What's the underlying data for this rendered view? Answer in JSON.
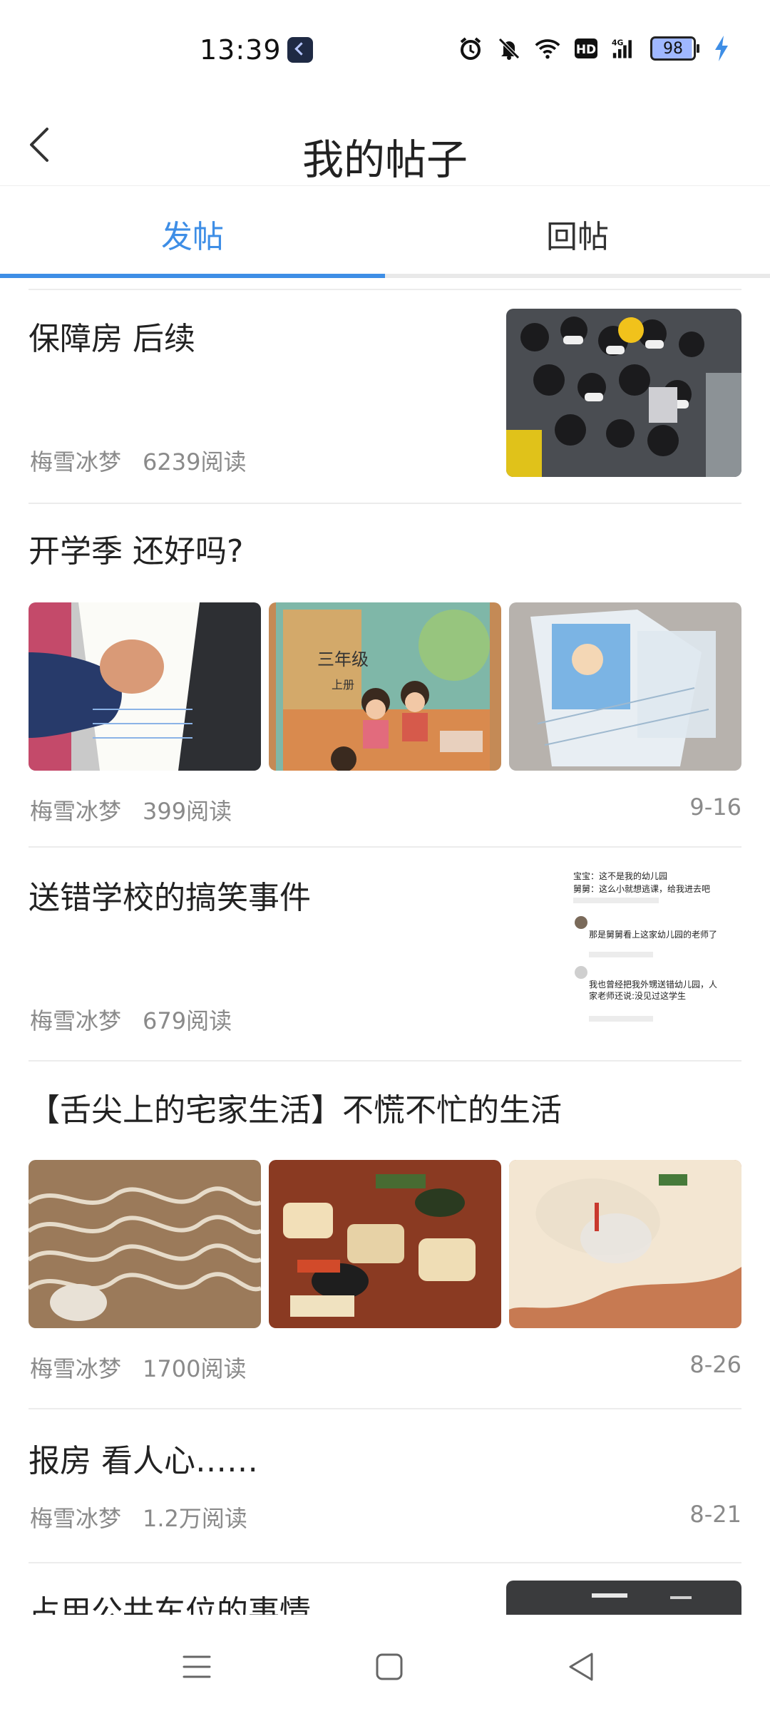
{
  "status_bar": {
    "time": "13:39",
    "battery": "98",
    "icons": [
      "alarm-icon",
      "mute-icon",
      "wifi-icon",
      "hd-icon",
      "4g-signal-icon",
      "battery-icon",
      "charging-icon"
    ]
  },
  "header": {
    "title": "我的帖子"
  },
  "tabs": [
    {
      "label": "发帖",
      "active": true
    },
    {
      "label": "回帖",
      "active": false
    }
  ],
  "colors": {
    "accent": "#3e8ee6"
  },
  "posts": [
    {
      "title": "保障房  后续",
      "author": "梅雪冰梦",
      "reads": "6239阅读",
      "date": ""
    },
    {
      "title": "开学季  还好吗?",
      "author": "梅雪冰梦",
      "reads": "399阅读",
      "date": "9-16",
      "image_labels": {
        "book_grade": "三年级",
        "book_volume": "上册"
      }
    },
    {
      "title": "送错学校的搞笑事件",
      "author": "梅雪冰梦",
      "reads": "679阅读",
      "date": "",
      "comment_screenshot": [
        "宝宝：这不是我的幼儿园",
        "舅舅：这么小就想逃课，给我进去吧",
        "那是舅舅看上这家幼儿园的老师了",
        "我也曾经把我外甥送错幼儿园，人家老师还说:没见过这学生"
      ]
    },
    {
      "title": "【舌尖上的宅家生活】不慌不忙的生活",
      "author": "梅雪冰梦",
      "reads": "1700阅读",
      "date": "8-26"
    },
    {
      "title": "报房  看人心……",
      "author": "梅雪冰梦",
      "reads": "1.2万阅读",
      "date": "8-21"
    },
    {
      "title": "占用公共车位的事情",
      "author": "",
      "reads": "",
      "date": ""
    }
  ]
}
